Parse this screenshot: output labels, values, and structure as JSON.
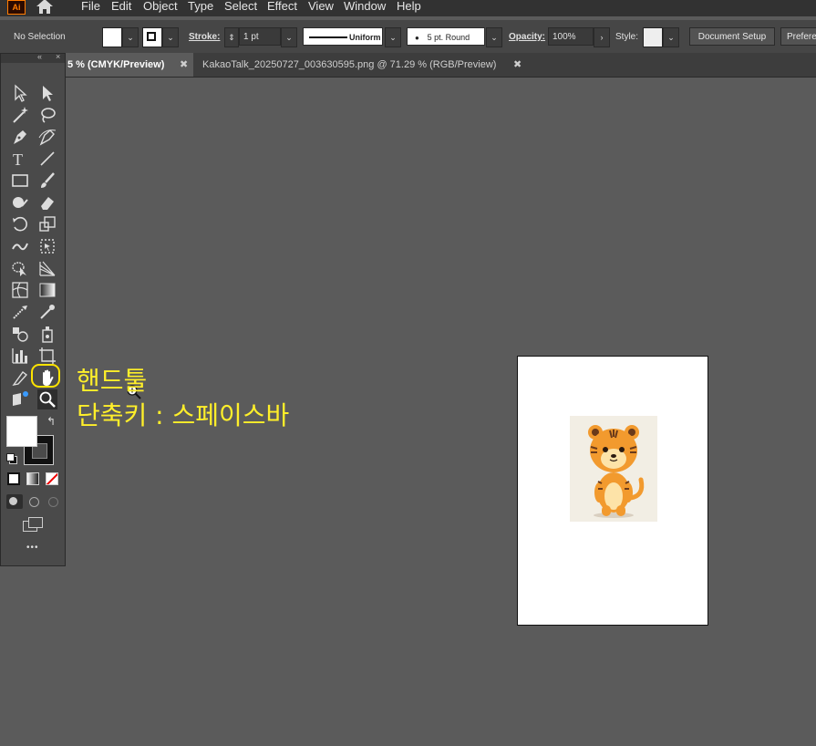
{
  "app": {
    "logo_text": "Ai"
  },
  "menu": [
    "File",
    "Edit",
    "Object",
    "Type",
    "Select",
    "Effect",
    "View",
    "Window",
    "Help"
  ],
  "control_bar": {
    "selection_status": "No Selection",
    "stroke_label": "Stroke:",
    "stroke_weight": "1 pt",
    "stroke_profile": "Uniform",
    "brush": "5 pt. Round",
    "opacity_label": "Opacity:",
    "opacity_value": "100%",
    "style_label": "Style:",
    "document_setup": "Document Setup",
    "preferences": "Prefere"
  },
  "tabs": [
    {
      "label": "5 % (CMYK/Preview)",
      "active": true
    },
    {
      "label": "KakaoTalk_20250727_003630595.png @ 71.29 % (RGB/Preview)",
      "active": false
    }
  ],
  "toolbar": {
    "more_label": "•••"
  },
  "annotation": {
    "line1": "핸드툴",
    "line2": "단축키 : 스페이스바"
  },
  "colors": {
    "accent_annotation": "#ffef2a",
    "canvas_bg": "#5b5b5b",
    "ui_dark": "#323232"
  }
}
